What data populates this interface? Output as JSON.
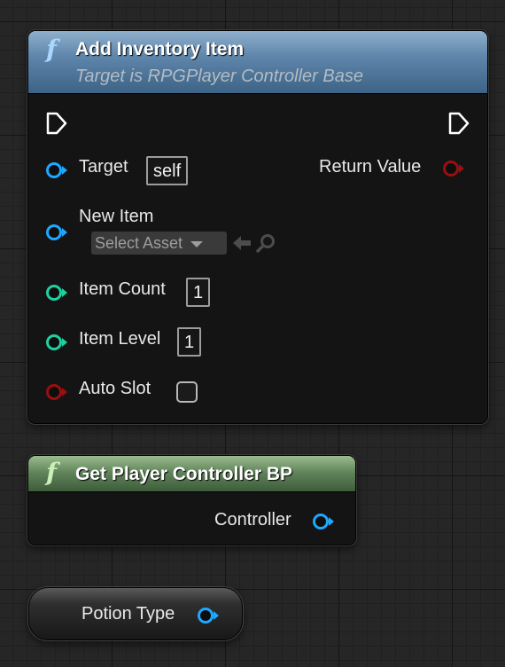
{
  "add_inventory_item": {
    "title": "Add Inventory Item",
    "subtitle": "Target is RPGPlayer Controller Base",
    "function_icon": "f",
    "target_label": "Target",
    "target_value": "self",
    "return_label": "Return Value",
    "new_item_label": "New Item",
    "new_item_select": "Select Asset",
    "item_count_label": "Item Count",
    "item_count_value": "1",
    "item_level_label": "Item Level",
    "item_level_value": "1",
    "auto_slot_label": "Auto Slot",
    "auto_slot_checked": false
  },
  "get_player_controller": {
    "title": "Get Player Controller BP",
    "function_icon": "f",
    "output_label": "Controller"
  },
  "potion_type": {
    "label": "Potion Type"
  },
  "colors": {
    "object_pin": "#1ea8ff",
    "int_pin": "#1fd0a0",
    "bool_pin": "#9a0f0f",
    "function_header": "#5f86ab",
    "pure_header": "#62855c"
  }
}
